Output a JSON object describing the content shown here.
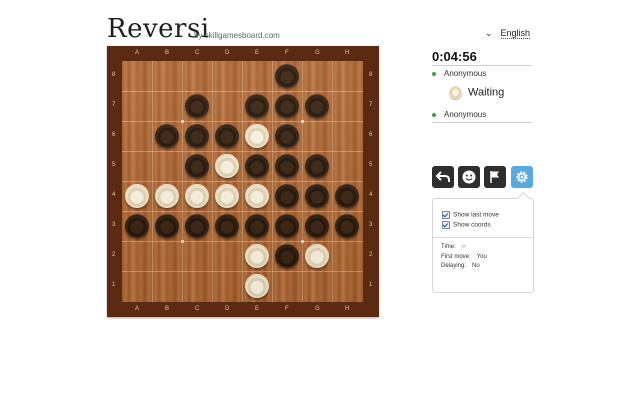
{
  "header": {
    "title": "Reversi",
    "byline": "by skillgamesboard.com",
    "language": "English"
  },
  "board": {
    "columns": [
      "A",
      "B",
      "C",
      "D",
      "E",
      "F",
      "G",
      "H"
    ],
    "rows": [
      "8",
      "7",
      "6",
      "5",
      "4",
      "3",
      "2",
      "1"
    ],
    "cells": [
      [
        "",
        "",
        "",
        "",
        "",
        "B",
        "",
        ""
      ],
      [
        "",
        "",
        "B",
        "",
        "B",
        "B",
        "B",
        ""
      ],
      [
        "",
        "B",
        "B",
        "B",
        "W",
        "B",
        "",
        ""
      ],
      [
        "",
        "",
        "B",
        "W",
        "B",
        "B",
        "B",
        ""
      ],
      [
        "W",
        "W",
        "W",
        "W",
        "W",
        "B",
        "B",
        "B"
      ],
      [
        "B",
        "B",
        "B",
        "B",
        "B",
        "B",
        "B",
        "B"
      ],
      [
        "",
        "",
        "",
        "",
        "W",
        "B",
        "W",
        ""
      ],
      [
        "",
        "",
        "",
        "",
        "W",
        "",
        "",
        ""
      ]
    ]
  },
  "game": {
    "timer": "0:04:56",
    "player_top": "Anonymous",
    "status": "Waiting",
    "player_bottom": "Anonymous"
  },
  "toolbar": {
    "undo": "undo-icon",
    "emoji": "smiley-icon",
    "resign": "flag-icon",
    "settings": "gear-icon"
  },
  "settings_panel": {
    "show_last_move": "Show last move",
    "show_coords": "Show coords",
    "time_label": "Time:",
    "time_value": "∞",
    "first_move_label": "First move:",
    "first_move_value": "You",
    "delaying_label": "Delaying:",
    "delaying_value": "No"
  },
  "colors": {
    "board_frame": "#5a2a12",
    "black_piece": "#2a180b",
    "white_piece": "#f4e9cf",
    "accent_blue": "#5aa8e0",
    "online_green": "#3aa535"
  }
}
